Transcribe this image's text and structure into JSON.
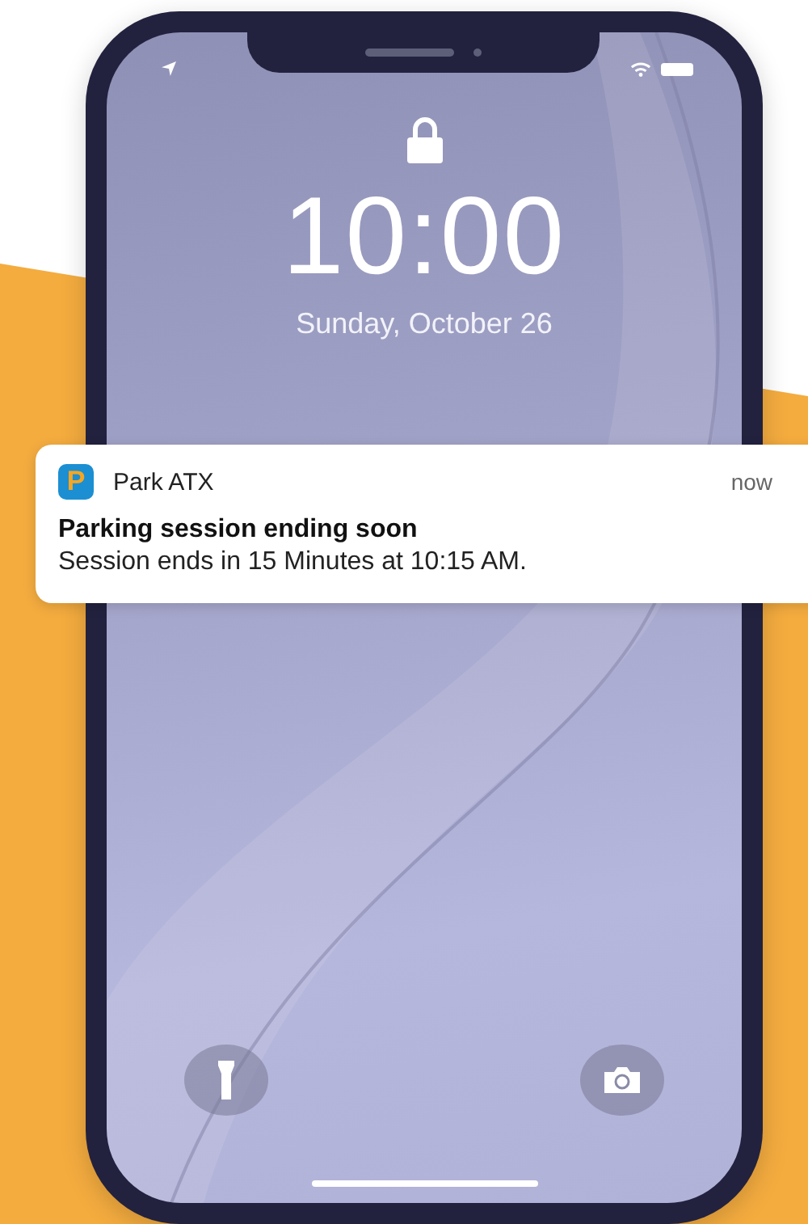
{
  "lock_screen": {
    "time": "10:00",
    "date": "Sunday, October 26"
  },
  "notification": {
    "app_name": "Park ATX",
    "app_icon_letter": "P",
    "timestamp": "now",
    "title": "Parking session ending soon",
    "body": "Session ends in 15 Minutes at 10:15 AM."
  }
}
